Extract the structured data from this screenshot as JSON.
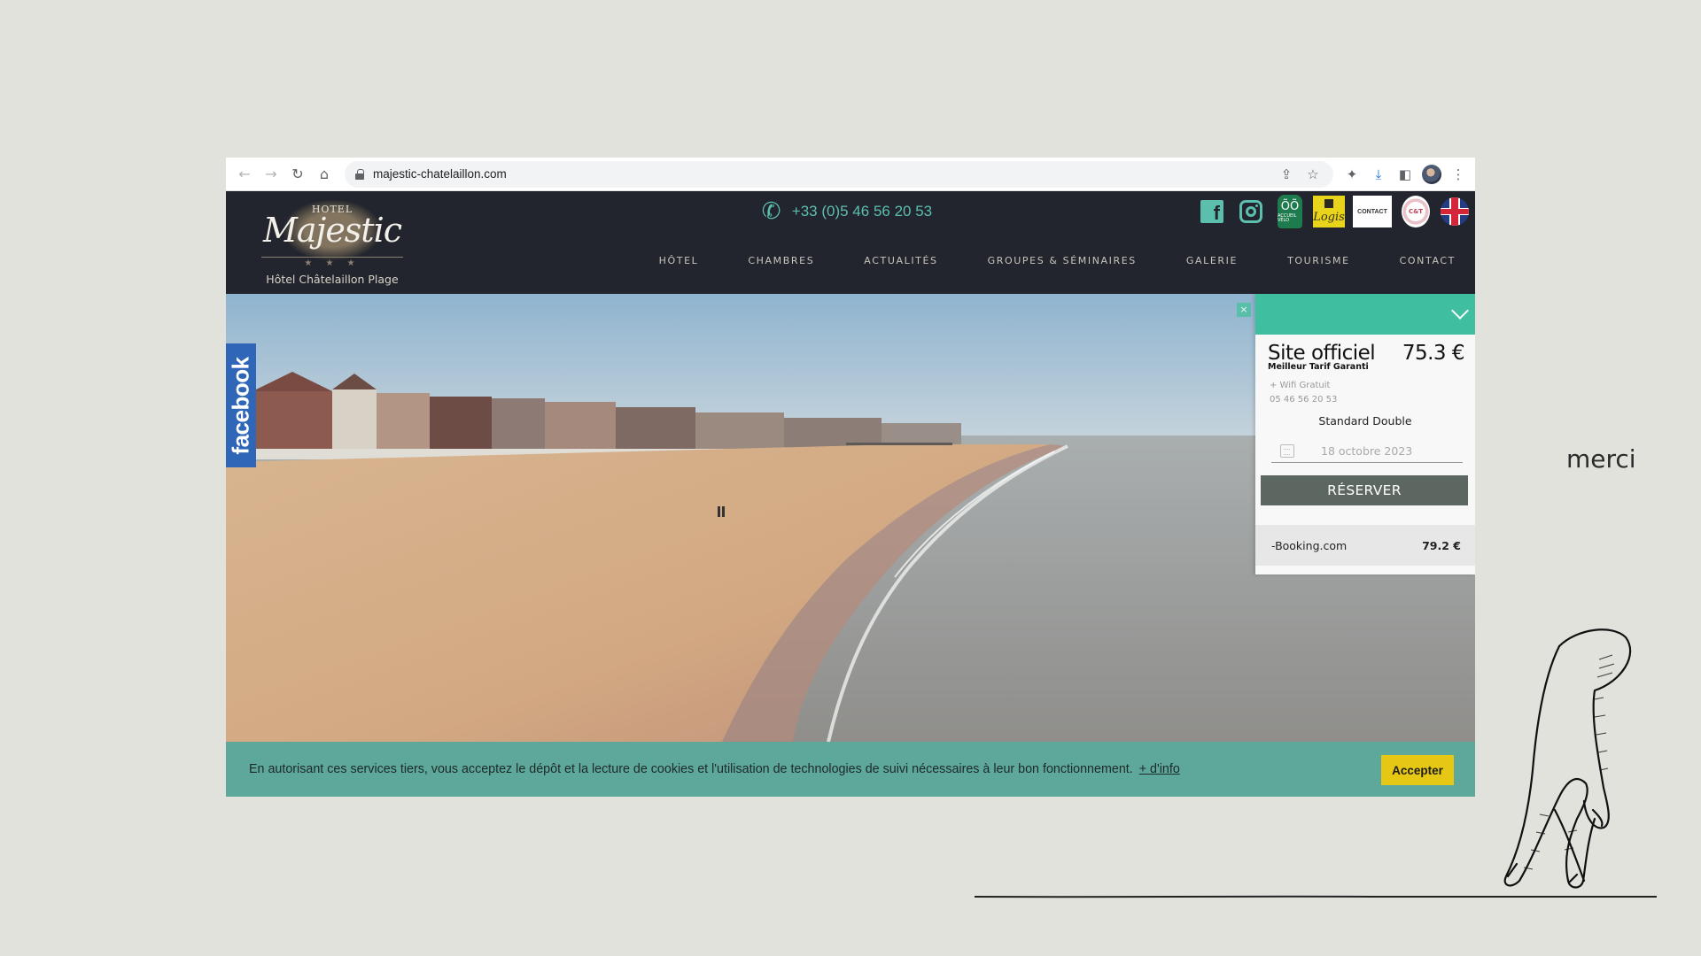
{
  "browser": {
    "url": "majestic-chatelaillon.com",
    "nav_icons": [
      "back-arrow-icon",
      "forward-arrow-icon",
      "reload-icon",
      "home-icon"
    ],
    "toolbar_icons": [
      "share-icon",
      "star-icon",
      "extensions-icon",
      "download-icon",
      "sidepanel-icon",
      "profile-avatar",
      "more-menu-icon"
    ]
  },
  "site": {
    "logo": {
      "top_text": "HOTEL",
      "brand": "Majestic",
      "stars": "★ ★ ★",
      "subtitle": "Hôtel Châtelaillon Plage"
    },
    "phone": {
      "icon": "phone-icon",
      "number": "+33 (0)5 46 56 20 53"
    },
    "social_icons": [
      {
        "name": "facebook-icon",
        "label": "f"
      },
      {
        "name": "instagram-icon",
        "label": ""
      },
      {
        "name": "accueil-velo-badge",
        "label": "ÕÕ",
        "sub": "ACCUEIL VÉLO"
      },
      {
        "name": "logis-badge",
        "label": "Logis"
      },
      {
        "name": "contact-hotel-badge",
        "label": "CONTACT"
      },
      {
        "name": "cot-label-badge",
        "label": "C&T"
      },
      {
        "name": "english-flag-icon",
        "label": ""
      }
    ],
    "nav": [
      "HÔTEL",
      "CHAMBRES",
      "ACTUALITÉS",
      "GROUPES & SÉMINAIRES",
      "GALERIE",
      "TOURISME",
      "CONTACT"
    ],
    "facebook_tab": "facebook",
    "hero_close": "×"
  },
  "booking": {
    "title": "Site officiel",
    "price": "75.3 €",
    "guarantee": "Meilleur Tarif Garanti",
    "extra_1": "+ Wifi Gratuit",
    "extra_2": "05 46 56 20 53",
    "room": "Standard Double",
    "date": "18 octobre 2023",
    "button": "RÉSERVER",
    "other_site": "-Booking.com",
    "other_price": "79.2 €"
  },
  "cookie": {
    "text": "En autorisant ces services tiers, vous acceptez le dépôt et la lecture de cookies et l'utilisation de technologies de suivi nécessaires à leur bon fonctionnement.",
    "more_link": "+ d'info",
    "accept": "Accepter"
  },
  "slide": {
    "caption": "merci"
  },
  "colors": {
    "accent": "#5cbfae",
    "booking_bar": "#3fbea0",
    "header_bg": "#23252e",
    "cookie_bg": "#5ea79b",
    "accept_btn": "#e6c814",
    "reserve_btn": "#5d6761",
    "facebook_blue": "#2f66b8",
    "slide_bg": "#e2e2dd"
  }
}
